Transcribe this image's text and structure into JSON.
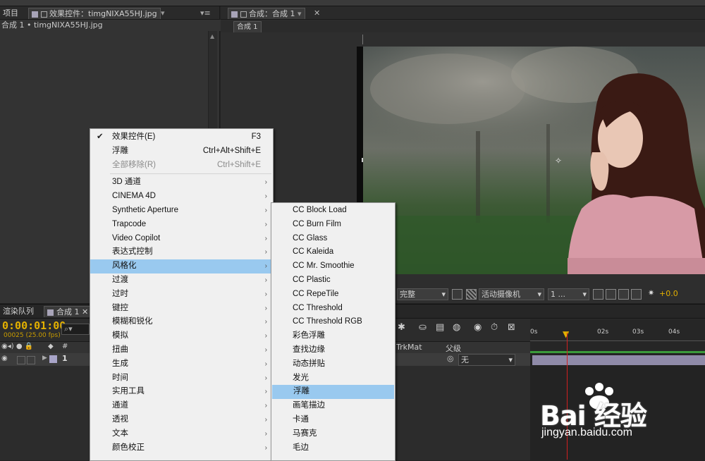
{
  "left_panel": {
    "tab_project": "项目",
    "tab_effect_controls": "效果控件：timgNIXA55HJ.jpg",
    "subtitle": "合成 1 • timgNIXA55HJ.jpg"
  },
  "comp_panel": {
    "tab_title": "合成：合成 1",
    "sub_tab": "合成 1",
    "toolbar": {
      "quality": "完整",
      "camera": "活动摄像机",
      "views": "1 ...",
      "exposure": "+0.0"
    }
  },
  "timeline": {
    "tab_render_queue": "渲染队列",
    "tab_comp": "合成 1",
    "timecode": "0:00:01:00",
    "frames": "00025 (25.00 fps)",
    "col_trkmat": "TrkMat",
    "col_parent": "父级",
    "layer_number": "1",
    "parent_value": "无",
    "ruler_labels": [
      "0s",
      "02s",
      "03s",
      "04s"
    ]
  },
  "context_menu": {
    "items": [
      {
        "label": "效果控件(E)",
        "shortcut": "F3",
        "checked": true
      },
      {
        "label": "浮雕",
        "shortcut": "Ctrl+Alt+Shift+E"
      },
      {
        "label": "全部移除(R)",
        "shortcut": "Ctrl+Shift+E",
        "disabled": true
      },
      {
        "label": "3D 通道",
        "submenu": true
      },
      {
        "label": "CINEMA 4D",
        "submenu": true
      },
      {
        "label": "Synthetic Aperture",
        "submenu": true
      },
      {
        "label": "Trapcode",
        "submenu": true
      },
      {
        "label": "Video Copilot",
        "submenu": true
      },
      {
        "label": "表达式控制",
        "submenu": true
      },
      {
        "label": "风格化",
        "submenu": true,
        "highlighted": true
      },
      {
        "label": "过渡",
        "submenu": true
      },
      {
        "label": "过时",
        "submenu": true
      },
      {
        "label": "键控",
        "submenu": true
      },
      {
        "label": "模糊和锐化",
        "submenu": true
      },
      {
        "label": "模拟",
        "submenu": true
      },
      {
        "label": "扭曲",
        "submenu": true
      },
      {
        "label": "生成",
        "submenu": true
      },
      {
        "label": "时间",
        "submenu": true
      },
      {
        "label": "实用工具",
        "submenu": true
      },
      {
        "label": "通道",
        "submenu": true
      },
      {
        "label": "透视",
        "submenu": true
      },
      {
        "label": "文本",
        "submenu": true
      },
      {
        "label": "颜色校正",
        "submenu": true
      }
    ]
  },
  "submenu": {
    "items": [
      {
        "label": "CC Block Load"
      },
      {
        "label": "CC Burn Film"
      },
      {
        "label": "CC Glass"
      },
      {
        "label": "CC Kaleida"
      },
      {
        "label": "CC Mr. Smoothie"
      },
      {
        "label": "CC Plastic"
      },
      {
        "label": "CC RepeTile"
      },
      {
        "label": "CC Threshold"
      },
      {
        "label": "CC Threshold RGB"
      },
      {
        "label": "彩色浮雕"
      },
      {
        "label": "查找边缘"
      },
      {
        "label": "动态拼贴"
      },
      {
        "label": "发光"
      },
      {
        "label": "浮雕",
        "highlighted": true
      },
      {
        "label": "画笔描边"
      },
      {
        "label": "卡通"
      },
      {
        "label": "马赛克"
      },
      {
        "label": "毛边"
      }
    ]
  },
  "watermark": {
    "logo": "Bai 经验",
    "url": "jingyan.baidu.com"
  },
  "colors": {
    "menu_highlight": "#99c9ef",
    "timecode": "#e3b000",
    "cti": "#d02020"
  }
}
